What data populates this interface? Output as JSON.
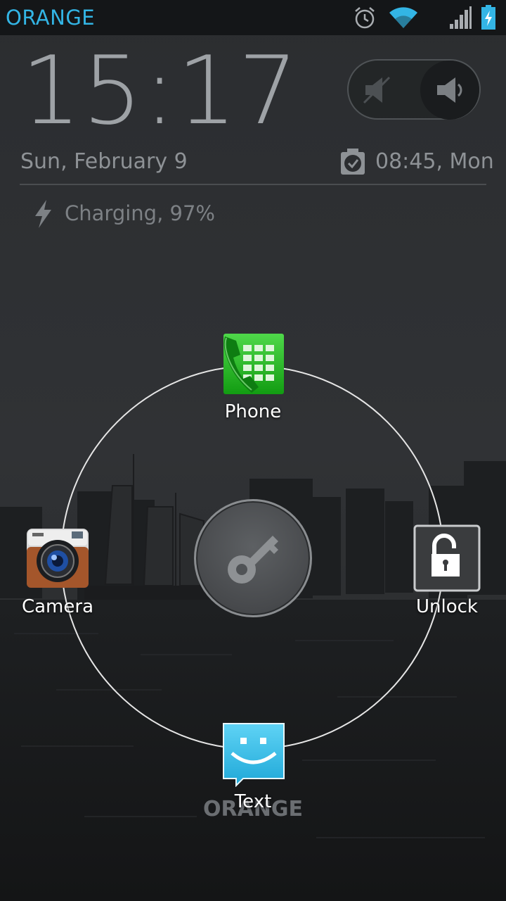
{
  "status_bar": {
    "carrier": "ORANGE",
    "icons": [
      "alarm-icon",
      "wifi-icon",
      "signal-icon",
      "battery-charging-icon"
    ]
  },
  "lockscreen": {
    "time": "15:17",
    "date": "Sun, February 9",
    "next_alarm": "08:45, Mon",
    "charging_status": "Charging, 97%",
    "owner_info": "ORANGE",
    "sound_toggle": {
      "state": "sound-on"
    }
  },
  "targets": {
    "phone": {
      "label": "Phone",
      "icon": "phone-app-icon"
    },
    "camera": {
      "label": "Camera",
      "icon": "camera-app-icon"
    },
    "unlock": {
      "label": "Unlock",
      "icon": "unlock-padlock-icon"
    },
    "text": {
      "label": "Text",
      "icon": "messaging-app-icon"
    },
    "center": {
      "icon": "key-icon"
    }
  },
  "colors": {
    "carrier": "#33b5e5",
    "clock": "#9ea2a6",
    "ring": "#e6e6e6"
  }
}
